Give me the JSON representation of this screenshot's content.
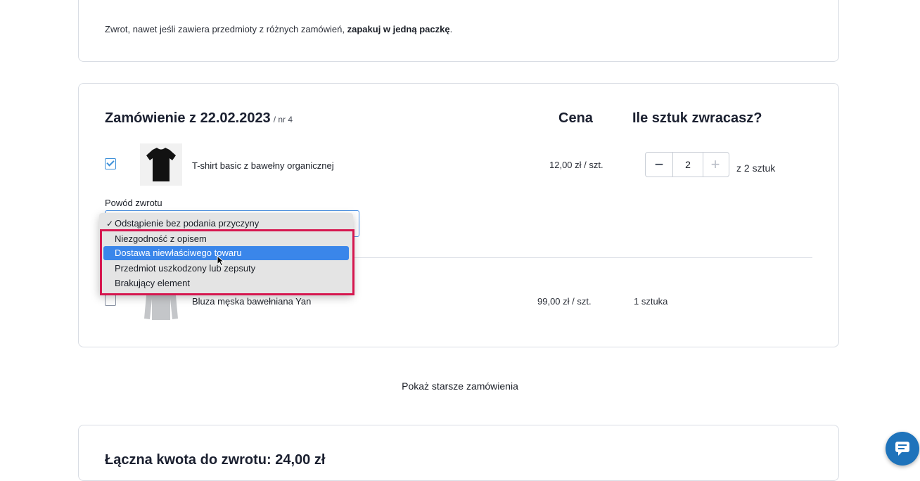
{
  "info": {
    "text_prefix": "Zwrot, nawet jeśli zawiera przedmioty z różnych zamówień, ",
    "text_bold": "zapakuj w jedną paczkę",
    "text_suffix": "."
  },
  "order": {
    "title": "Zamówienie z 22.02.2023",
    "number": "/ nr 4",
    "col_price": "Cena",
    "col_qty": "Ile sztuk zwracasz?",
    "items": [
      {
        "name": "T-shirt basic z bawełny organicznej",
        "price": "12,00 zł / szt.",
        "checked": true,
        "quantity_value": "2",
        "quantity_of": "z 2 sztuk",
        "minus": "−",
        "plus": "+"
      },
      {
        "name": "Bluza męska bawełniana Yan",
        "price": "99,00 zł / szt.",
        "checked": false,
        "quantity_static": "1 sztuka"
      }
    ],
    "reason_label": "Powód zwrotu",
    "reason_options": [
      "Odstąpienie bez podania przyczyny",
      "Niezgodność z opisem",
      "Dostawa niewłaściwego towaru",
      "Przedmiot uszkodzony lub zepsuty",
      "Brakujący element"
    ],
    "reason_selected": "Odstąpienie bez podania przyczyny",
    "reason_hovered": "Dostawa niewłaściwego towaru"
  },
  "older_orders_link": "Pokaż starsze zamówienia",
  "total": {
    "title": "Łączna kwota do zwrotu: 24,00 zł"
  },
  "colors": {
    "accent": "#3a86ea",
    "highlight_frame": "#d6174f",
    "chat_button": "#1e73bb"
  }
}
